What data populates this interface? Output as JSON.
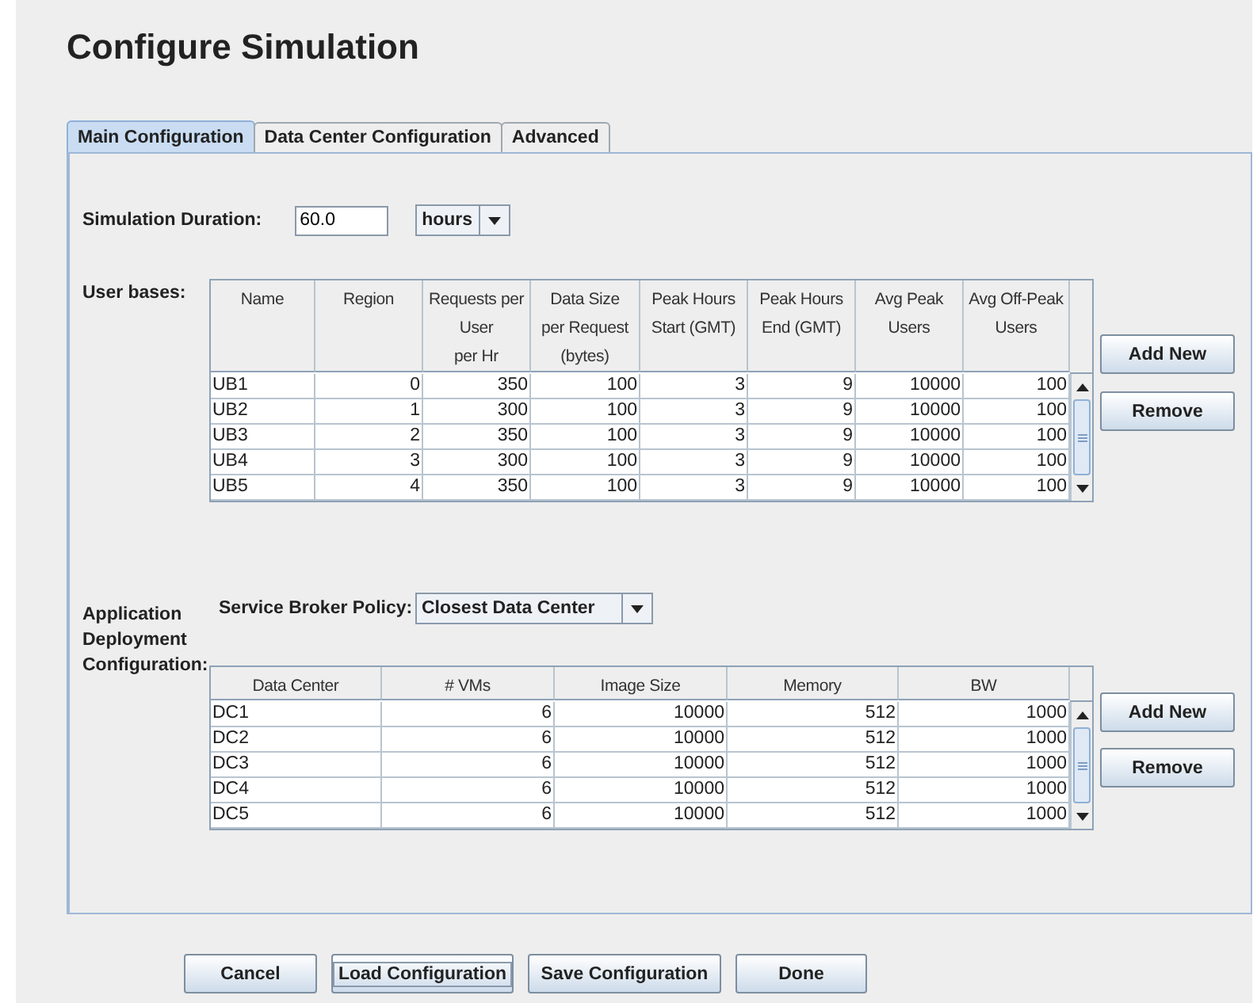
{
  "title": "Configure Simulation",
  "tabs": [
    {
      "label": "Main Configuration",
      "selected": true
    },
    {
      "label": "Data Center Configuration",
      "selected": false
    },
    {
      "label": "Advanced",
      "selected": false
    }
  ],
  "simulation_duration": {
    "label": "Simulation Duration:",
    "value": "60.0",
    "unit": "hours"
  },
  "user_bases": {
    "label": "User bases:",
    "columns": [
      "Name",
      "Region",
      "Requests per\nUser\nper Hr",
      "Data Size\nper Request\n(bytes)",
      "Peak Hours\nStart (GMT)",
      "Peak Hours\nEnd (GMT)",
      "Avg Peak\nUsers",
      "Avg Off-Peak\nUsers"
    ],
    "rows": [
      [
        "UB1",
        "0",
        "350",
        "100",
        "3",
        "9",
        "10000",
        "100"
      ],
      [
        "UB2",
        "1",
        "300",
        "100",
        "3",
        "9",
        "10000",
        "100"
      ],
      [
        "UB3",
        "2",
        "350",
        "100",
        "3",
        "9",
        "10000",
        "100"
      ],
      [
        "UB4",
        "3",
        "300",
        "100",
        "3",
        "9",
        "10000",
        "100"
      ],
      [
        "UB5",
        "4",
        "350",
        "100",
        "3",
        "9",
        "10000",
        "100"
      ]
    ],
    "buttons": [
      "Add New",
      "Remove"
    ]
  },
  "deployment": {
    "label_lines": [
      "Application",
      "Deployment",
      "Configuration:"
    ],
    "policy_label": "Service Broker Policy:",
    "policy": "Closest Data Center",
    "columns": [
      "Data Center",
      "# VMs",
      "Image Size",
      "Memory",
      "BW"
    ],
    "rows": [
      [
        "DC1",
        "6",
        "10000",
        "512",
        "1000"
      ],
      [
        "DC2",
        "6",
        "10000",
        "512",
        "1000"
      ],
      [
        "DC3",
        "6",
        "10000",
        "512",
        "1000"
      ],
      [
        "DC4",
        "6",
        "10000",
        "512",
        "1000"
      ],
      [
        "DC5",
        "6",
        "10000",
        "512",
        "1000"
      ]
    ],
    "buttons": [
      "Add New",
      "Remove"
    ]
  },
  "footer_buttons": [
    {
      "label": "Cancel",
      "focused": false
    },
    {
      "label": "Load Configuration",
      "focused": true
    },
    {
      "label": "Save Configuration",
      "focused": false
    },
    {
      "label": "Done",
      "focused": false
    }
  ]
}
